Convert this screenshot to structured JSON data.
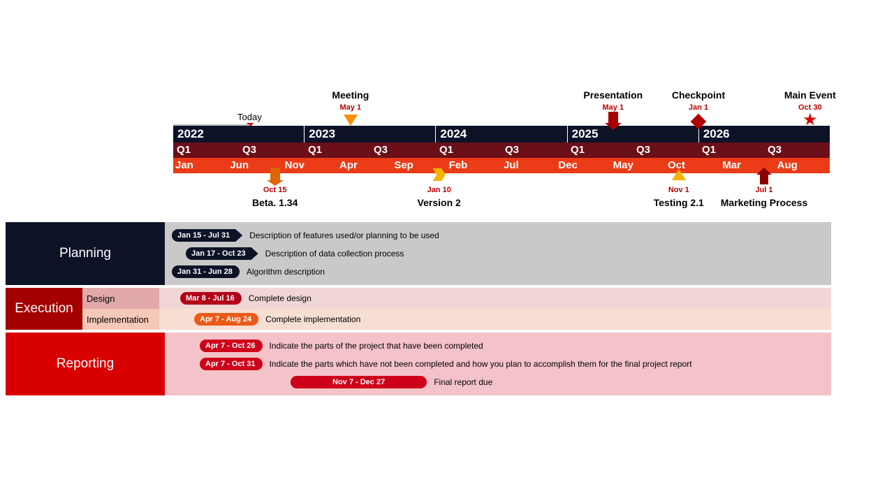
{
  "timeline": {
    "today_label": "Today",
    "today_position_pct": 11.5,
    "years": [
      "2022",
      "2023",
      "2024",
      "2025",
      "2026"
    ],
    "quarters": [
      "Q1",
      "Q3",
      "Q1",
      "Q3",
      "Q1",
      "Q3",
      "Q1",
      "Q3",
      "Q1",
      "Q3"
    ],
    "months": [
      "Jan",
      "Jun",
      "Nov",
      "Apr",
      "Sep",
      "Feb",
      "Jul",
      "Dec",
      "May",
      "Oct",
      "Mar",
      "Aug"
    ]
  },
  "milestones_top": [
    {
      "title": "Meeting",
      "date": "May 1",
      "pos_pct": 27,
      "shape": "tri-orange"
    },
    {
      "title": "Presentation",
      "date": "May 1",
      "pos_pct": 67,
      "shape": "arrow-red"
    },
    {
      "title": "Checkpoint",
      "date": "Jan 1",
      "pos_pct": 80,
      "shape": "diamond"
    },
    {
      "title": "Main Event",
      "date": "Oct 30",
      "pos_pct": 97,
      "shape": "star"
    }
  ],
  "milestones_bottom": [
    {
      "title": "Beta. 1.34",
      "date": "Oct 15",
      "pos_pct": 15.5,
      "shape": "flag-orange"
    },
    {
      "title": "Version 2",
      "date": "Jan 10",
      "pos_pct": 40.5,
      "shape": "chevron"
    },
    {
      "title": "Testing 2.1",
      "date": "Nov 1",
      "pos_pct": 77,
      "shape": "tri-yellow"
    },
    {
      "title": "Marketing Process",
      "date": "Jul 1",
      "pos_pct": 90,
      "shape": "arrow-up-red"
    }
  ],
  "lanes": {
    "planning": {
      "label": "Planning",
      "head_bg": "#0c1327",
      "body_bg": "#c9c9c9",
      "tasks": [
        {
          "pill": "Jan 15 - Jul 31",
          "pill_bg": "#0c1327",
          "arrow": true,
          "offset": 0,
          "desc": "Description of features used/or planning to be used"
        },
        {
          "pill": "Jan 17 - Oct 23",
          "pill_bg": "#0c1327",
          "arrow": true,
          "offset": 20,
          "desc": "Description of data collection process"
        },
        {
          "pill": "Jan 31 - Jun 28",
          "pill_bg": "#0c1327",
          "arrow": false,
          "offset": 0,
          "desc": "Algorithm description"
        }
      ]
    },
    "execution": {
      "label": "Execution",
      "head_bg": "#a50000",
      "sub1": {
        "label": "Design",
        "bg": "#e2a9a9"
      },
      "sub2": {
        "label": "Implementation",
        "bg": "#f5c8b8"
      },
      "tasks": [
        {
          "pill": "Mar 8 - Jul 16",
          "pill_bg": "#b30018",
          "offset": 20,
          "body_bg": "#f1d6d6",
          "desc": "Complete design"
        },
        {
          "pill": "Apr 7 - Aug 24",
          "pill_bg": "#eb5a17",
          "offset": 40,
          "body_bg": "#f6ded2",
          "desc": "Complete implementation"
        }
      ]
    },
    "reporting": {
      "label": "Reporting",
      "head_bg": "#d80000",
      "body_bg": "#f3c3c9",
      "tasks": [
        {
          "pill": "Apr 7 - Oct 26",
          "pill_bg": "#cf001a",
          "offset": 40,
          "desc": "Indicate the parts of the project that have been completed"
        },
        {
          "pill": "Apr 7 - Oct 31",
          "pill_bg": "#cf001a",
          "offset": 40,
          "desc": "Indicate the parts which have not been completed and how you plan to accomplish them for the final project report"
        },
        {
          "pill": "Nov 7 - Dec 27",
          "pill_bg": "#cf001a",
          "offset": 170,
          "wide": true,
          "desc": "Final report due"
        }
      ]
    }
  }
}
